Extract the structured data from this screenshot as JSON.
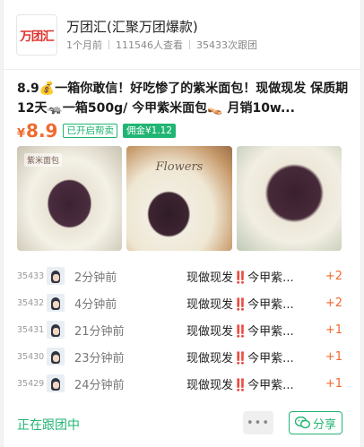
{
  "shop": {
    "logo_text": "万团汇",
    "name": "万团汇(汇聚万团爆款)",
    "age": "1个月前",
    "views": "111546人查看",
    "follows": "35433次跟团"
  },
  "product": {
    "title": "8.9💰一箱你敢信！好吃惨了的紫米面包！现做现发 保质期12天🦡一箱500g/ 今甲紫米面包👡 月销10w...",
    "price_currency": "¥",
    "price_value": "8.9",
    "tag_help": "已开启帮卖",
    "tag_commission": "佣金¥1.12",
    "image_banner": "紫米面包",
    "image_overlay": "Flowers"
  },
  "orders": [
    {
      "seq": "35433",
      "time": "2分钟前",
      "item": "现做现发‼️今甲紫...",
      "count": "+2"
    },
    {
      "seq": "35432",
      "time": "4分钟前",
      "item": "现做现发‼️今甲紫...",
      "count": "+2"
    },
    {
      "seq": "35431",
      "time": "21分钟前",
      "item": "现做现发‼️今甲紫...",
      "count": "+1"
    },
    {
      "seq": "35430",
      "time": "23分钟前",
      "item": "现做现发‼️今甲紫...",
      "count": "+1"
    },
    {
      "seq": "35429",
      "time": "24分钟前",
      "item": "现做现发‼️今甲紫...",
      "count": "+1"
    }
  ],
  "footer": {
    "status": "正在跟团中",
    "more_label": "•••",
    "share_label": "分享",
    "share_icon": "wechat-icon"
  },
  "colors": {
    "accent_green": "#21b573",
    "price_orange": "#ef6a2f",
    "logo_red": "#e0312c"
  }
}
